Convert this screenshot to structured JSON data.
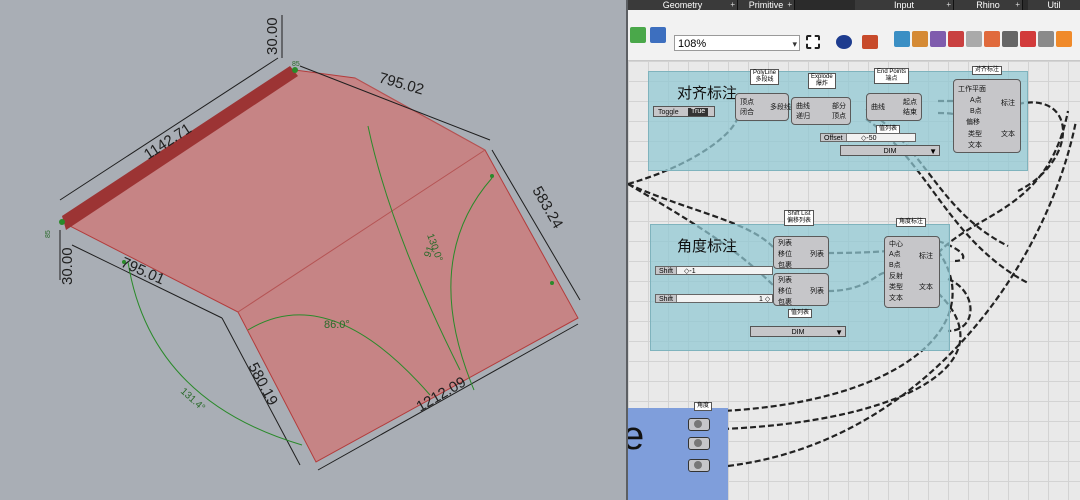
{
  "viewport": {
    "dimensions": {
      "top_length": "30.00",
      "top_right_edge": "795.02",
      "left_long_edge": "1142.71",
      "right_edge": "583.24",
      "left_short": "30.00",
      "lower_left_edge": "795.01",
      "lower_vertical": "580.19",
      "bottom_edge": "1212.09",
      "angle_center": "86.0°",
      "angle_right": "130.0°",
      "angle_right2": "91",
      "angle_left": "131.4°",
      "tiny_top": "85",
      "tiny_left": "85"
    },
    "colors": {
      "surface": "#c98080",
      "edge": "#b33c3c",
      "annotation": "#1f1f1f",
      "angle_arc": "#2a8a2a"
    }
  },
  "grasshopper": {
    "tabs": [
      "Geometry",
      "Primitive",
      "Input",
      "Rhino",
      "Util"
    ],
    "zoom": "108%",
    "groups": {
      "align_title": "对齐标注",
      "angle_title": "角度标注"
    },
    "components": {
      "toggle": {
        "name": "Toggle",
        "value": "True"
      },
      "polyline": {
        "caption": "PolyLine\n多段线",
        "in1": "顶点",
        "in2": "闭合",
        "out": "多段线"
      },
      "explode": {
        "caption": "Explode\n爆炸",
        "in1": "曲线",
        "in2": "递归",
        "out1": "部分",
        "out2": "顶点"
      },
      "endpoints": {
        "caption": "End Points\n端点",
        "in": "曲线",
        "out1": "起点",
        "out2": "结束"
      },
      "aligned_dim": {
        "caption": "对齐标注",
        "in": [
          "工作平面",
          "A点",
          "B点",
          "偏移",
          "类型",
          "文本"
        ],
        "out1": "标注",
        "out2": "文本"
      },
      "offset_slider": {
        "name": "Offset",
        "value": "◇-50"
      },
      "list_cap1": "值列表",
      "dim_list1": "DIM",
      "shift_list": {
        "caption": "Shift List\n偏移列表",
        "in": [
          "列表",
          "移位",
          "包裹"
        ],
        "out": "列表"
      },
      "shift1": {
        "name": "Shift",
        "value": "◇-1"
      },
      "shift2": {
        "name": "Shift",
        "value": "1 ◇"
      },
      "angle_dim": {
        "caption": "角度标注",
        "in": [
          "中心",
          "A点",
          "B点",
          "反射",
          "类型",
          "文本"
        ],
        "out1": "标注",
        "out2": "文本"
      },
      "list_cap2": "值列表",
      "dim_list2": "DIM",
      "blue_big": "e",
      "blue_cap": "角度"
    }
  }
}
